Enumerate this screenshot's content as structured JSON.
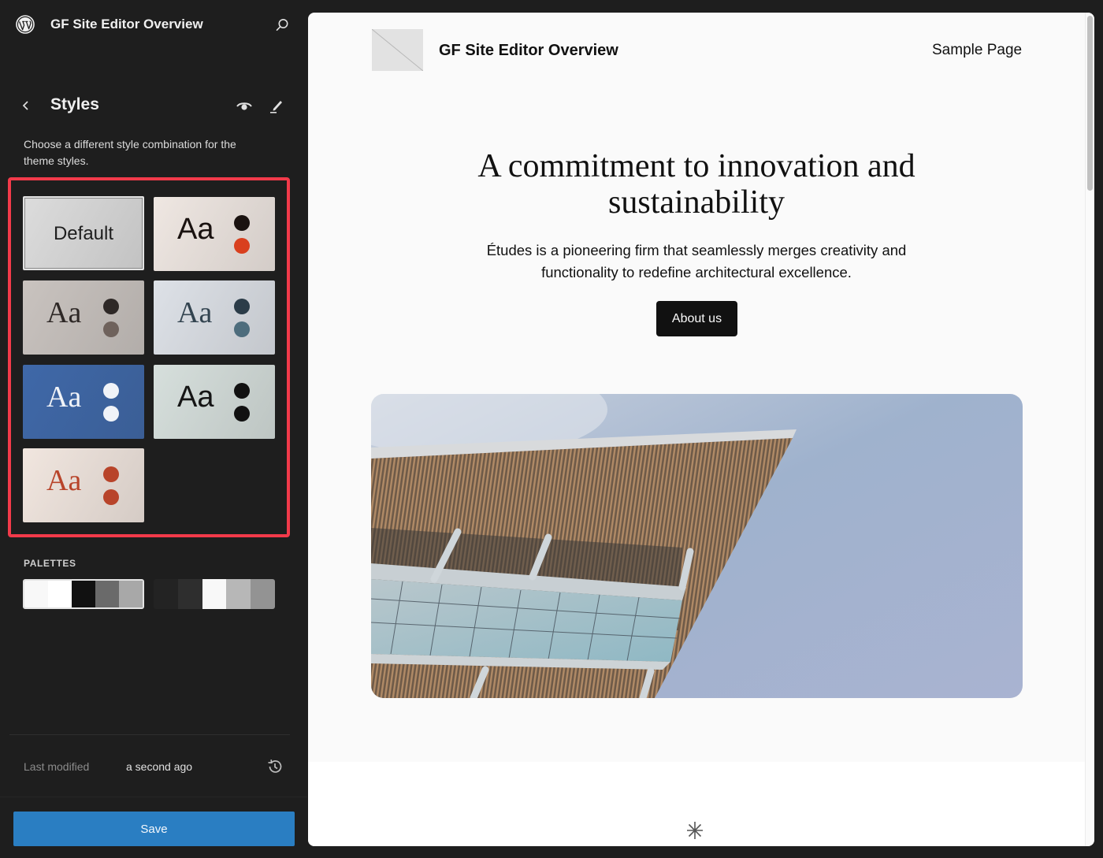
{
  "sidebar": {
    "site_title": "GF Site Editor Overview",
    "icons": {
      "logo": "wordpress-logo-icon",
      "search": "search-icon",
      "back": "chevron-left-icon",
      "preview": "eye-icon",
      "edit": "pencil-icon",
      "history": "history-icon"
    },
    "panel_title": "Styles",
    "description": "Choose a different style combination for the theme styles.",
    "variations": [
      {
        "label": "Default",
        "selected": true,
        "bg": "#dcdcdc",
        "text_color": "#1e1e1e",
        "dots": []
      },
      {
        "label": "Aa",
        "selected": false,
        "bg": "#efe7e2",
        "text_color": "#1a1210",
        "dots": [
          "#1a1210",
          "#d9401e"
        ]
      },
      {
        "label": "Aa",
        "selected": false,
        "bg": "#c9c3bf",
        "text_color": "#2e2826",
        "dots": [
          "#2e2826",
          "#6f625c"
        ]
      },
      {
        "label": "Aa",
        "selected": false,
        "bg": "#dde1e7",
        "text_color": "#334450",
        "dots": [
          "#2b3c48",
          "#4e6d7d"
        ]
      },
      {
        "label": "Aa",
        "selected": false,
        "bg": "#3f68a8",
        "text_color": "#f0f3f8",
        "dots": [
          "#f0f3f8",
          "#f0f3f8"
        ]
      },
      {
        "label": "Aa",
        "selected": false,
        "bg": "#d6dfdc",
        "text_color": "#151515",
        "dots": [
          "#111111",
          "#111111"
        ]
      },
      {
        "label": "Aa",
        "selected": false,
        "bg": "#f1e6df",
        "text_color": "#b8442a",
        "dots": [
          "#b8442a",
          "#b8442a"
        ]
      }
    ],
    "palettes_label": "PALETTES",
    "palettes": [
      {
        "selected": true,
        "colors": [
          "#f8f8f8",
          "#ffffff",
          "#111111",
          "#6a6a6a",
          "#a8a8a8"
        ]
      },
      {
        "selected": false,
        "colors": [
          "#232323",
          "#2e2e2e",
          "#f8f8f8",
          "#b7b7b7",
          "#939393"
        ]
      }
    ],
    "last_modified_label": "Last modified",
    "last_modified_value": "a second ago",
    "save_label": "Save",
    "highlight_color": "#f23a4a",
    "accent_color": "#2a7ec2"
  },
  "preview": {
    "site_title": "GF Site Editor Overview",
    "nav_link": "Sample Page",
    "hero_heading": "A commitment to innovation and sustainability",
    "hero_text": "Études is a pioneering firm that seamlessly merges creativity and functionality to redefine architectural excellence.",
    "cta_label": "About us",
    "hero_image": "architecture-building-photo",
    "separator_icon": "asterisk-icon"
  }
}
